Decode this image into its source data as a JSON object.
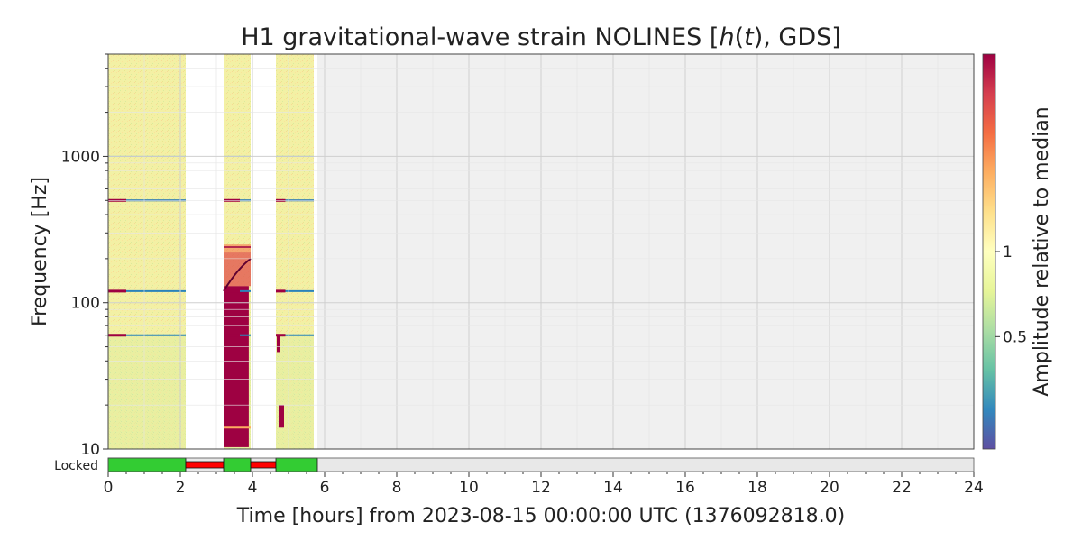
{
  "chart_data": {
    "type": "heatmap",
    "title": "H1 gravitational-wave strain NOLINES [h(t), GDS]",
    "title_parts": {
      "prefix": "H1 gravitational-wave strain NOLINES [",
      "h": "h",
      "open_paren": "(",
      "t": "t",
      "suffix": "), GDS]"
    },
    "xlabel": "Time [hours] from 2023-08-15 00:00:00 UTC (1376092818.0)",
    "ylabel": "Frequency [Hz]",
    "colorbar_label": "Amplitude relative to median",
    "xlim": [
      0,
      24
    ],
    "ylim": [
      10,
      5000
    ],
    "yscale": "log",
    "x_ticks": [
      0,
      2,
      4,
      6,
      8,
      10,
      12,
      14,
      16,
      18,
      20,
      22,
      24
    ],
    "y_ticks": [
      10,
      100,
      1000
    ],
    "colorbar_ticks": [
      0.5,
      1
    ],
    "colorbar_range": [
      0.2,
      5
    ],
    "colorbar_scale": "log",
    "colormap": "Spectral_r",
    "grid": true,
    "no_data_after_hours": 5.8,
    "data_segments": [
      {
        "start": 0.0,
        "end": 2.15,
        "state": "normal"
      },
      {
        "start": 3.2,
        "end": 3.95,
        "state": "glitchy"
      },
      {
        "start": 4.65,
        "end": 5.7,
        "state": "normal"
      }
    ],
    "spectral_lines": [
      {
        "freq": 60,
        "cls": "low"
      },
      {
        "freq": 120,
        "cls": "low"
      },
      {
        "freq": 500,
        "cls": "mixed"
      },
      {
        "freq": 1000,
        "cls": "faint"
      }
    ],
    "state_bar": {
      "label": "Locked",
      "segments": [
        {
          "start": 0.0,
          "end": 2.15,
          "state": "locked"
        },
        {
          "start": 2.15,
          "end": 3.2,
          "state": "unlocked"
        },
        {
          "start": 3.2,
          "end": 3.95,
          "state": "locked"
        },
        {
          "start": 3.95,
          "end": 4.65,
          "state": "unlocked"
        },
        {
          "start": 4.65,
          "end": 5.8,
          "state": "locked"
        }
      ],
      "colors": {
        "locked": "#33cc33",
        "unlocked": "#ff0000",
        "unknown": "#e8e8e8"
      }
    }
  }
}
